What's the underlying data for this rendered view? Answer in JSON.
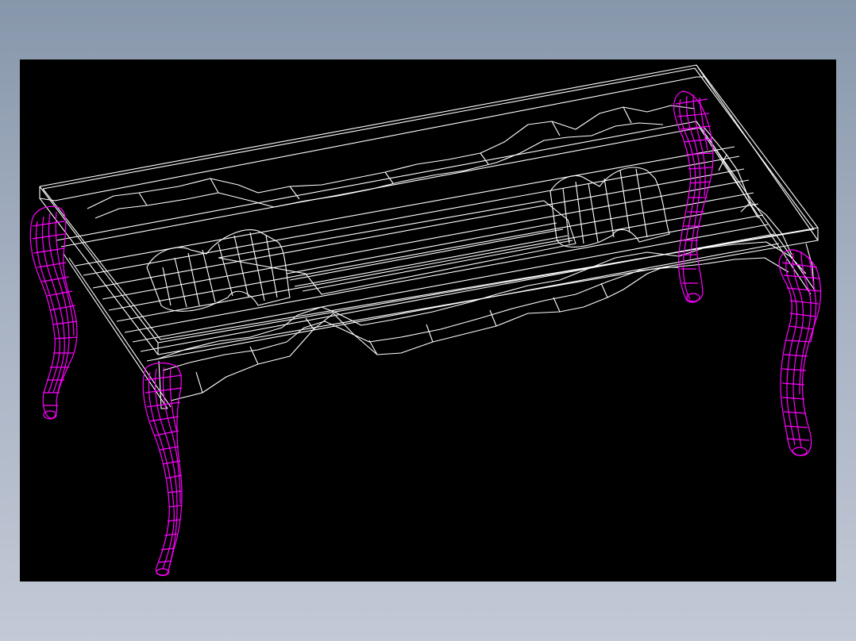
{
  "viewport": {
    "background": "#000000",
    "model": "table-wireframe"
  },
  "colors": {
    "page_gradient_top": "#8797ab",
    "page_gradient_bottom": "#c3c9d6",
    "tabletop_lines": "#ffffff",
    "leg_lines": "#ff00ff"
  },
  "icons": []
}
